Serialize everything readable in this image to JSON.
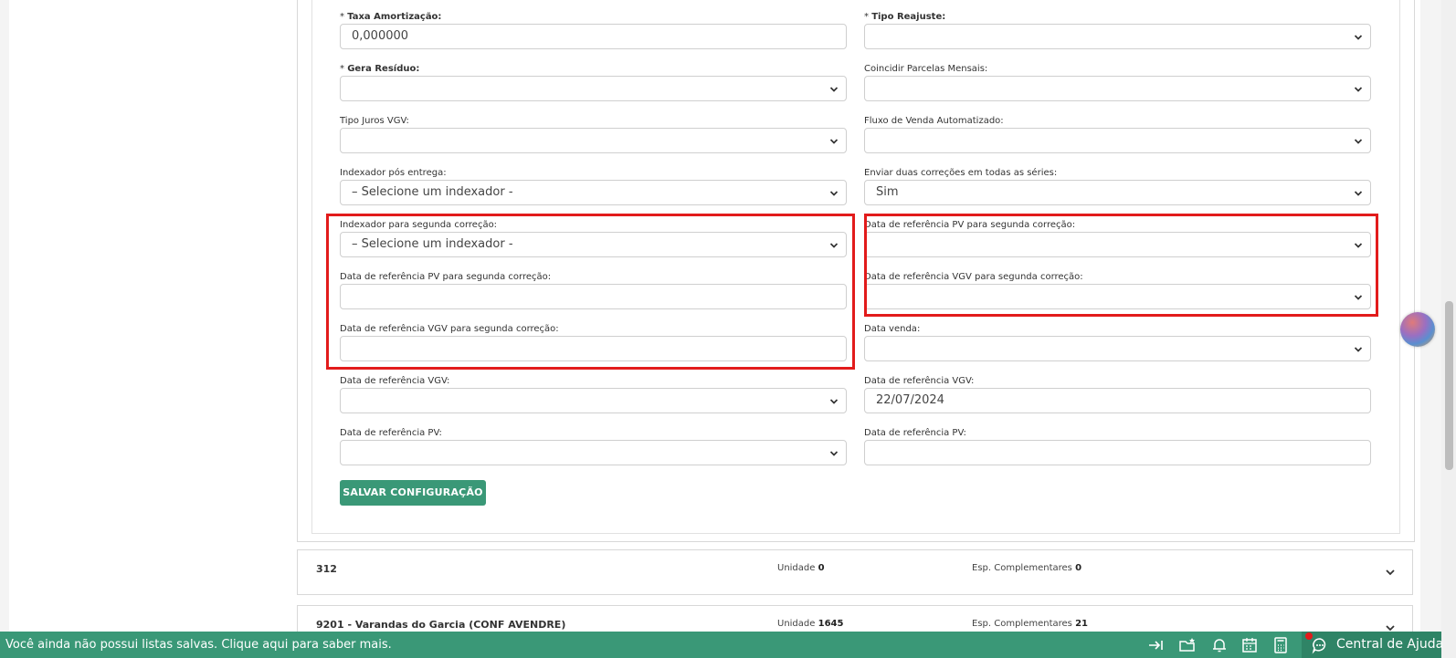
{
  "form": {
    "left": [
      {
        "label_req": "* ",
        "label": "Taxa Amortização:",
        "bold": true,
        "type": "input",
        "value": "0,000000"
      },
      {
        "label_req": "* ",
        "label": "Gera Resíduo:",
        "bold": true,
        "type": "select",
        "value": ""
      },
      {
        "label_req": "",
        "label": "Tipo Juros VGV:",
        "bold": false,
        "type": "select",
        "value": ""
      },
      {
        "label_req": "",
        "label": "Indexador pós entrega:",
        "bold": false,
        "type": "select",
        "value": "– Selecione um indexador -"
      },
      {
        "label_req": "",
        "label": "Indexador para segunda correção:",
        "bold": false,
        "type": "select",
        "value": "– Selecione um indexador -"
      },
      {
        "label_req": "",
        "label": "Data de referência PV para segunda correção:",
        "bold": false,
        "type": "input",
        "value": ""
      },
      {
        "label_req": "",
        "label": "Data de referência VGV para segunda correção:",
        "bold": false,
        "type": "input",
        "value": ""
      },
      {
        "label_req": "",
        "label": "Data de referência VGV:",
        "bold": false,
        "type": "select",
        "value": ""
      },
      {
        "label_req": "",
        "label": "Data de referência PV:",
        "bold": false,
        "type": "select",
        "value": ""
      }
    ],
    "right": [
      {
        "label_req": "* ",
        "label": "Tipo Reajuste:",
        "bold": true,
        "type": "select",
        "value": ""
      },
      {
        "label_req": "",
        "label": "Coincidir Parcelas Mensais:",
        "bold": false,
        "type": "select",
        "value": ""
      },
      {
        "label_req": "",
        "label": "Fluxo de Venda Automatizado:",
        "bold": false,
        "type": "select",
        "value": ""
      },
      {
        "label_req": "",
        "label": "Enviar duas correções em todas as séries:",
        "bold": false,
        "type": "select",
        "value": "Sim"
      },
      {
        "label_req": "",
        "label": "Data de referência PV para segunda correção:",
        "bold": false,
        "type": "select",
        "value": ""
      },
      {
        "label_req": "",
        "label": "Data de referência VGV para segunda correção:",
        "bold": false,
        "type": "select",
        "value": ""
      },
      {
        "label_req": "",
        "label": "Data venda:",
        "bold": false,
        "type": "select",
        "value": ""
      },
      {
        "label_req": "",
        "label": "Data de referência VGV:",
        "bold": false,
        "type": "input",
        "value": "22/07/2024"
      },
      {
        "label_req": "",
        "label": "Data de referência PV:",
        "bold": false,
        "type": "input",
        "value": ""
      }
    ],
    "save_label": "SALVAR CONFIGURAÇÃO"
  },
  "list": [
    {
      "code": "312",
      "unit_label": "Unidade",
      "unit_value": "0",
      "esp_label": "Esp. Complementares",
      "esp_value": "0"
    },
    {
      "code": "9201 - Varandas do Garcia (CONF AVENDRE)",
      "unit_label": "Unidade",
      "unit_value": "1645",
      "esp_label": "Esp. Complementares",
      "esp_value": "21"
    }
  ],
  "bottom_bar": {
    "message": "Você ainda não possui listas salvas. Clique aqui para saber mais.",
    "help_label": "Central de Ajuda",
    "icons": [
      "arrow-to-line-icon",
      "folder-star-icon",
      "bell-icon",
      "calendar-icon",
      "calculator-icon",
      "chat-icon"
    ]
  },
  "colors": {
    "accent": "#3a9877",
    "highlight": "#e21b1b"
  }
}
